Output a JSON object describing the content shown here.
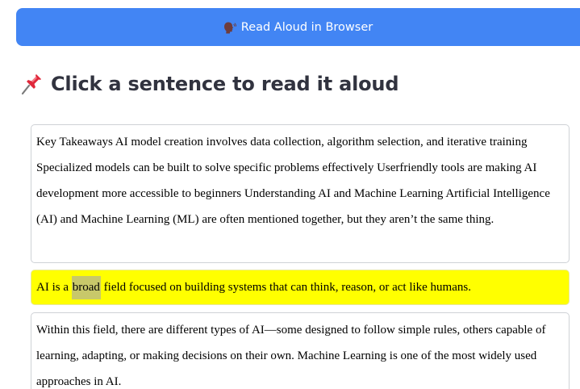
{
  "read_button": {
    "label": "Read Aloud in Browser",
    "icon": "speaking-head-icon"
  },
  "heading": {
    "icon": "pushpin-icon",
    "text": "Click a sentence to read it aloud"
  },
  "sentences": [
    {
      "text": "Key Takeaways AI model creation involves data collection, algorithm selection, and iterative training Specialized models can be built to solve specific problems effectively Userfriendly tools are making AI development more accessible to beginners Understanding AI and Machine Learning Artificial Intelligence (AI) and Machine Learning (ML) are often mentioned together, but they aren’t the same thing."
    },
    {
      "before": "AI is a ",
      "highlighted_word": "broad",
      "after": " field focused on building systems that can think, reason, or act like humans.",
      "active": true
    },
    {
      "text": "Within this field, there are different types of AI—some designed to follow simple rules, others capable of learning, adapting, or making decisions on their own. Machine Learning is one of the most widely used approaches in AI."
    }
  ],
  "colors": {
    "button_bg": "#4285f4",
    "active_sentence_bg": "#ffff00",
    "word_highlight": "#c8c86a"
  }
}
